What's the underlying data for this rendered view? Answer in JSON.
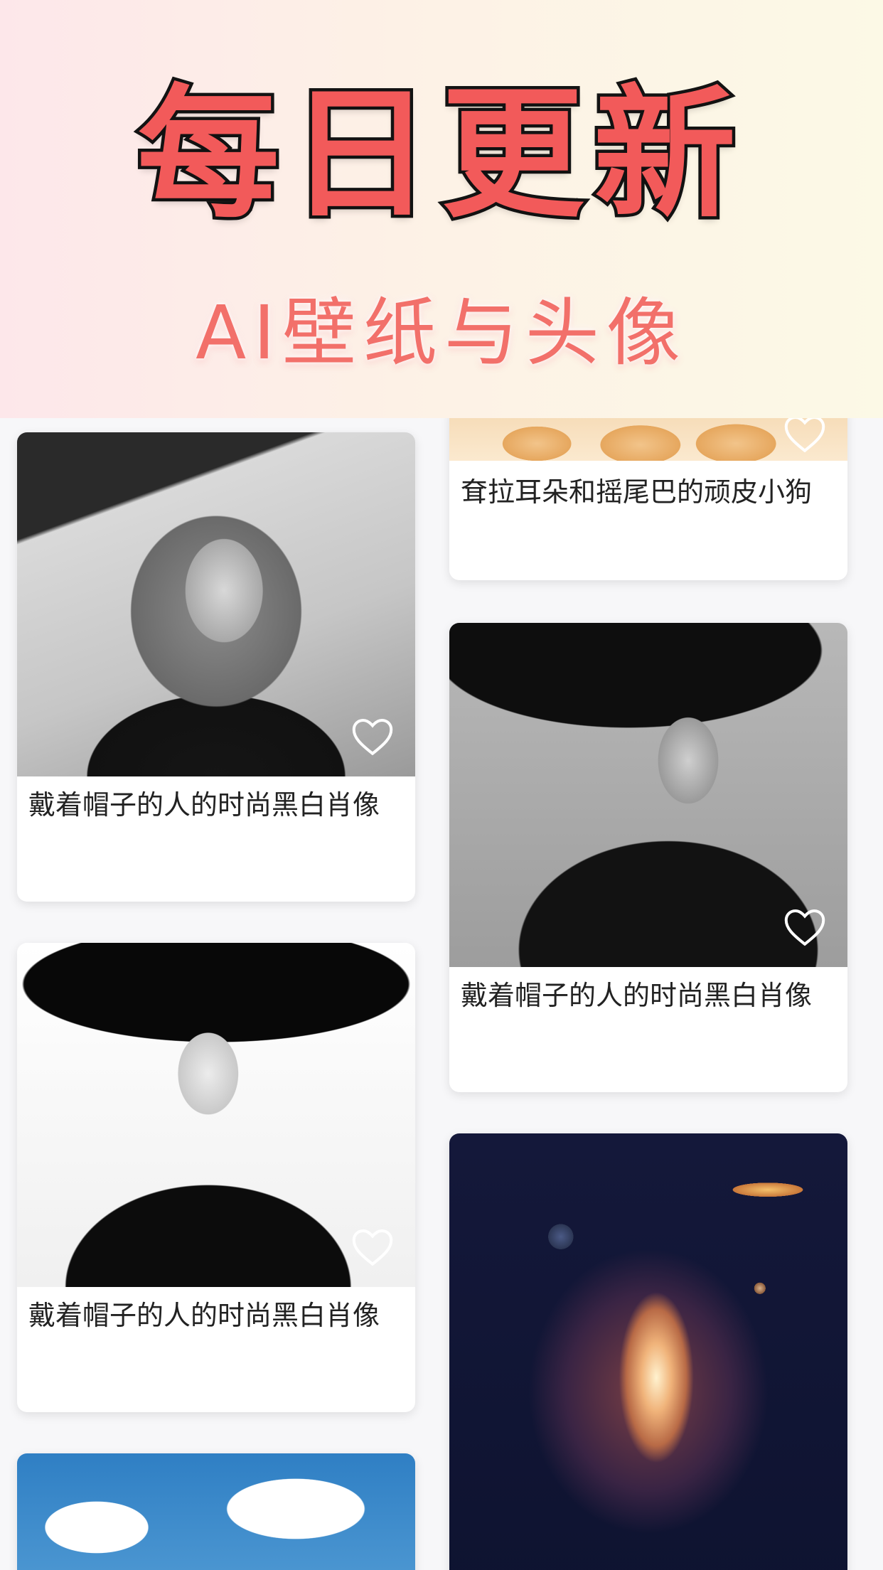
{
  "promo": {
    "title": "每日更新",
    "subtitle": "AI壁纸与头像"
  },
  "feed": {
    "left_column": [
      {
        "caption": "戴着帽子的人的时尚黑白肖像",
        "image": "black-white-portrait-hat",
        "favorite_icon": "heart-outline-icon"
      },
      {
        "caption": "戴着帽子的人的时尚黑白肖像",
        "image": "black-white-portrait-hat-earrings",
        "favorite_icon": "heart-outline-icon"
      },
      {
        "caption": "",
        "image": "blue-sky-clouds",
        "favorite_icon": "heart-outline-icon"
      }
    ],
    "right_column": [
      {
        "caption": "耷拉耳朵和摇尾巴的顽皮小狗",
        "image": "puppy-paws",
        "favorite_icon": "heart-outline-icon"
      },
      {
        "caption": "戴着帽子的人的时尚黑白肖像",
        "image": "black-white-portrait-hat-shadow",
        "favorite_icon": "heart-outline-icon"
      },
      {
        "caption": "",
        "image": "spiral-galaxy-planets",
        "favorite_icon": "heart-outline-icon"
      }
    ]
  },
  "colors": {
    "title_fill": "#f25a5a",
    "title_stroke": "#141414",
    "subtitle": "#f2706a",
    "caption_text": "#222222"
  }
}
